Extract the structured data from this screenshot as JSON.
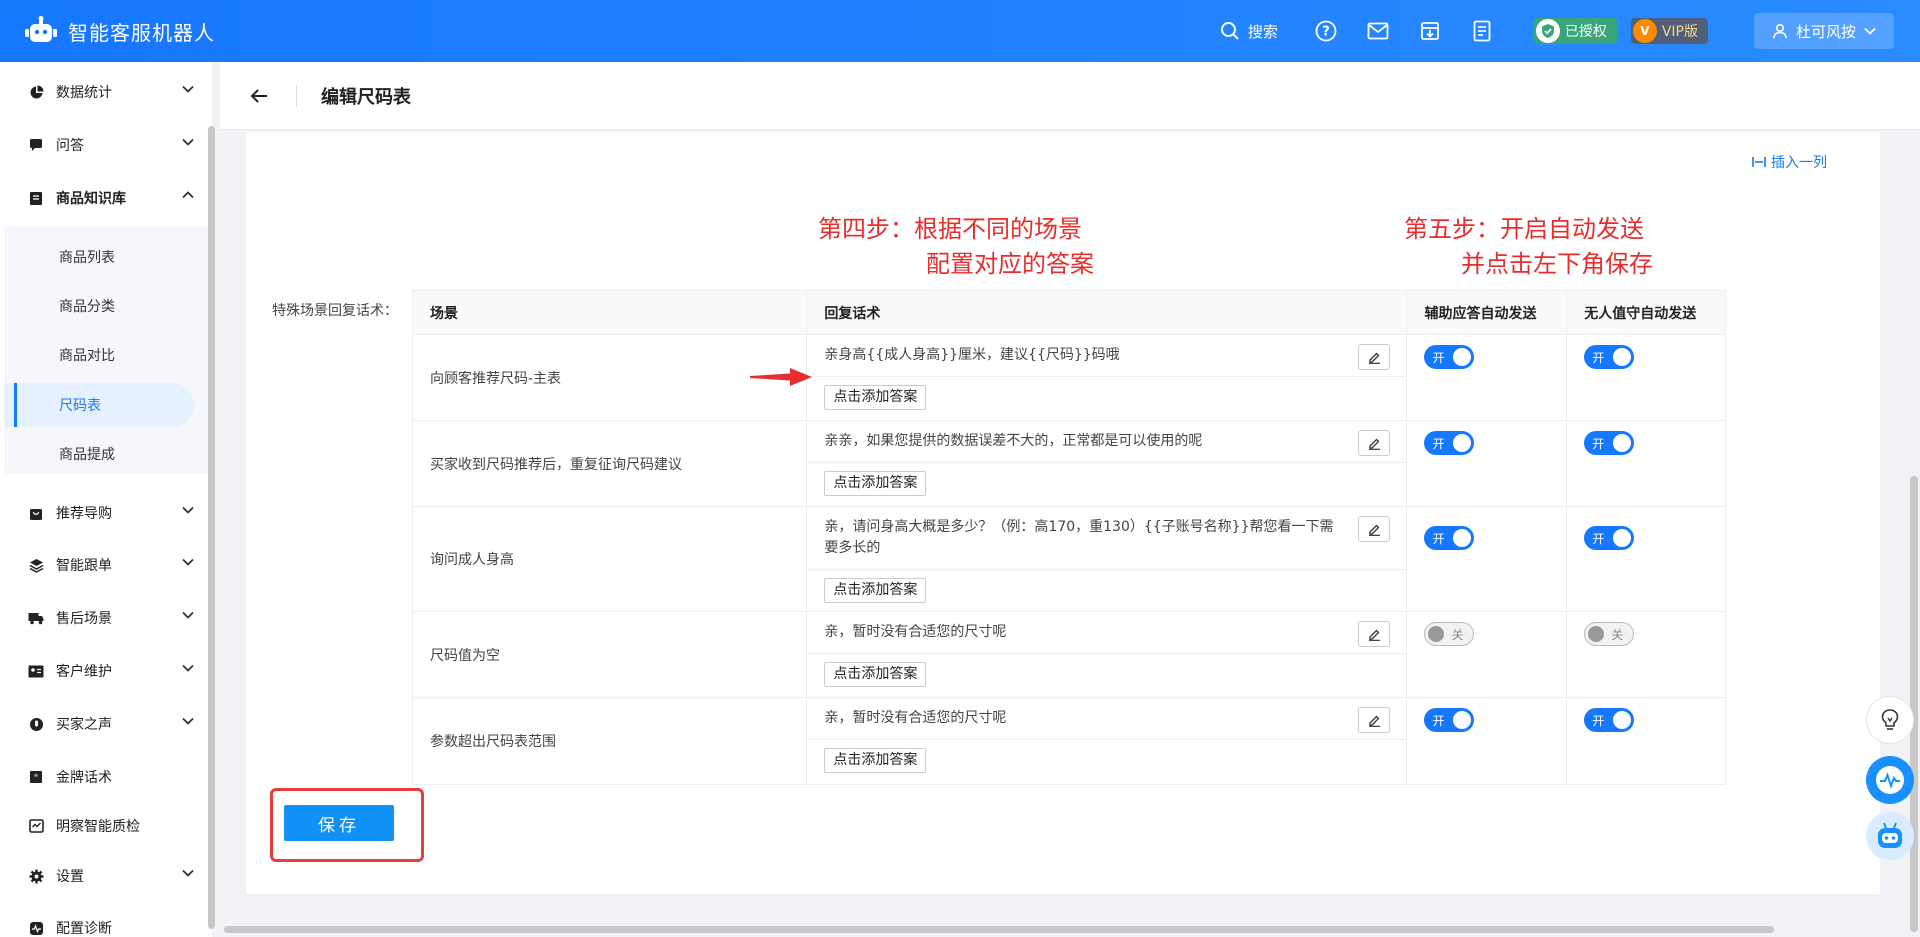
{
  "app": {
    "title": "智能客服机器人"
  },
  "topbar": {
    "search_label": "搜索",
    "authorized_label": "已授权",
    "vip_label": "VIP版",
    "user_name": "杜可风按"
  },
  "sidebar": {
    "items": [
      {
        "label": "数据统计"
      },
      {
        "label": "问答"
      },
      {
        "label": "商品知识库"
      },
      {
        "label": "推荐导购"
      },
      {
        "label": "智能跟单"
      },
      {
        "label": "售后场景"
      },
      {
        "label": "客户维护"
      },
      {
        "label": "买家之声"
      },
      {
        "label": "金牌话术"
      },
      {
        "label": "明察智能质检"
      },
      {
        "label": "设置"
      },
      {
        "label": "配置诊断"
      }
    ],
    "sub_items": [
      {
        "label": "商品列表"
      },
      {
        "label": "商品分类"
      },
      {
        "label": "商品对比"
      },
      {
        "label": "尺码表"
      },
      {
        "label": "商品提成"
      }
    ]
  },
  "page": {
    "title": "编辑尺码表",
    "insert_column_label": "插入一列",
    "form_label": "特殊场景回复话术：",
    "annotation_step4_line1": "第四步：根据不同的场景",
    "annotation_step4_line2": "配置对应的答案",
    "annotation_step5_line1": "第五步：开启自动发送",
    "annotation_step5_line2": "并点击左下角保存",
    "save_label": "保存"
  },
  "table": {
    "headers": [
      "场景",
      "回复话术",
      "辅助应答自动发送",
      "无人值守自动发送"
    ],
    "add_answer_label": "点击添加答案",
    "on_label": "开",
    "off_label": "关",
    "rows": [
      {
        "scene": "向顾客推荐尺码-主表",
        "reply": "亲身高{{成人身高}}厘米，建议{{尺码}}码哦",
        "assist_auto": true,
        "unattended_auto": true
      },
      {
        "scene": "买家收到尺码推荐后，重复征询尺码建议",
        "reply": "亲亲，如果您提供的数据误差不大的，正常都是可以使用的呢",
        "assist_auto": true,
        "unattended_auto": true
      },
      {
        "scene": "询问成人身高",
        "reply": "亲，请问身高大概是多少？（例：高170，重130）{{子账号名称}}帮您看一下需要多长的",
        "assist_auto": true,
        "unattended_auto": true
      },
      {
        "scene": "尺码值为空",
        "reply": "亲，暂时没有合适您的尺寸呢",
        "assist_auto": false,
        "unattended_auto": false
      },
      {
        "scene": "参数超出尺码表范围",
        "reply": "亲，暂时没有合适您的尺寸呢",
        "assist_auto": true,
        "unattended_auto": true
      }
    ]
  },
  "colors": {
    "primary": "#1677ff",
    "annotation": "#e62e2e",
    "save": "#1190f5"
  }
}
